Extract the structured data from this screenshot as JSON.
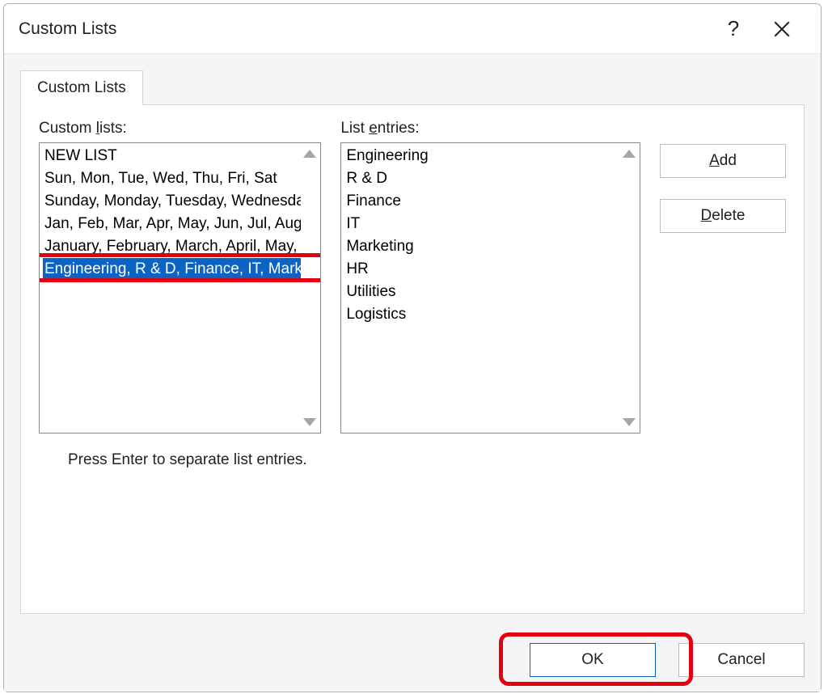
{
  "dialog": {
    "title": "Custom Lists",
    "help_symbol": "?",
    "close_symbol": "✕"
  },
  "tab": {
    "label": "Custom Lists"
  },
  "labels": {
    "custom_lists_pre": "Custom ",
    "custom_lists_ul": "l",
    "custom_lists_post": "ists:",
    "list_entries_pre": "List ",
    "list_entries_ul": "e",
    "list_entries_post": "ntries:",
    "hint": "Press Enter to separate list entries."
  },
  "custom_lists": {
    "items": [
      "NEW LIST",
      "Sun, Mon, Tue, Wed, Thu, Fri, Sat",
      "Sunday, Monday, Tuesday, Wednesday, Thursday, Friday, Saturday",
      "Jan, Feb, Mar, Apr, May, Jun, Jul, Aug, Sep, Oct, Nov, Dec",
      "January, February, March, April, May, June, July, August, September, October, November, December",
      "Engineering, R & D, Finance, IT, Marketing, HR, Utilities, Logistics"
    ],
    "selected_index": 5
  },
  "list_entries": {
    "items": [
      "Engineering",
      "R & D",
      "Finance",
      "IT",
      "Marketing",
      "HR",
      "Utilities",
      "Logistics"
    ]
  },
  "buttons": {
    "add_ul": "A",
    "add_post": "dd",
    "delete_ul": "D",
    "delete_post": "elete",
    "ok": "OK",
    "cancel": "Cancel"
  }
}
